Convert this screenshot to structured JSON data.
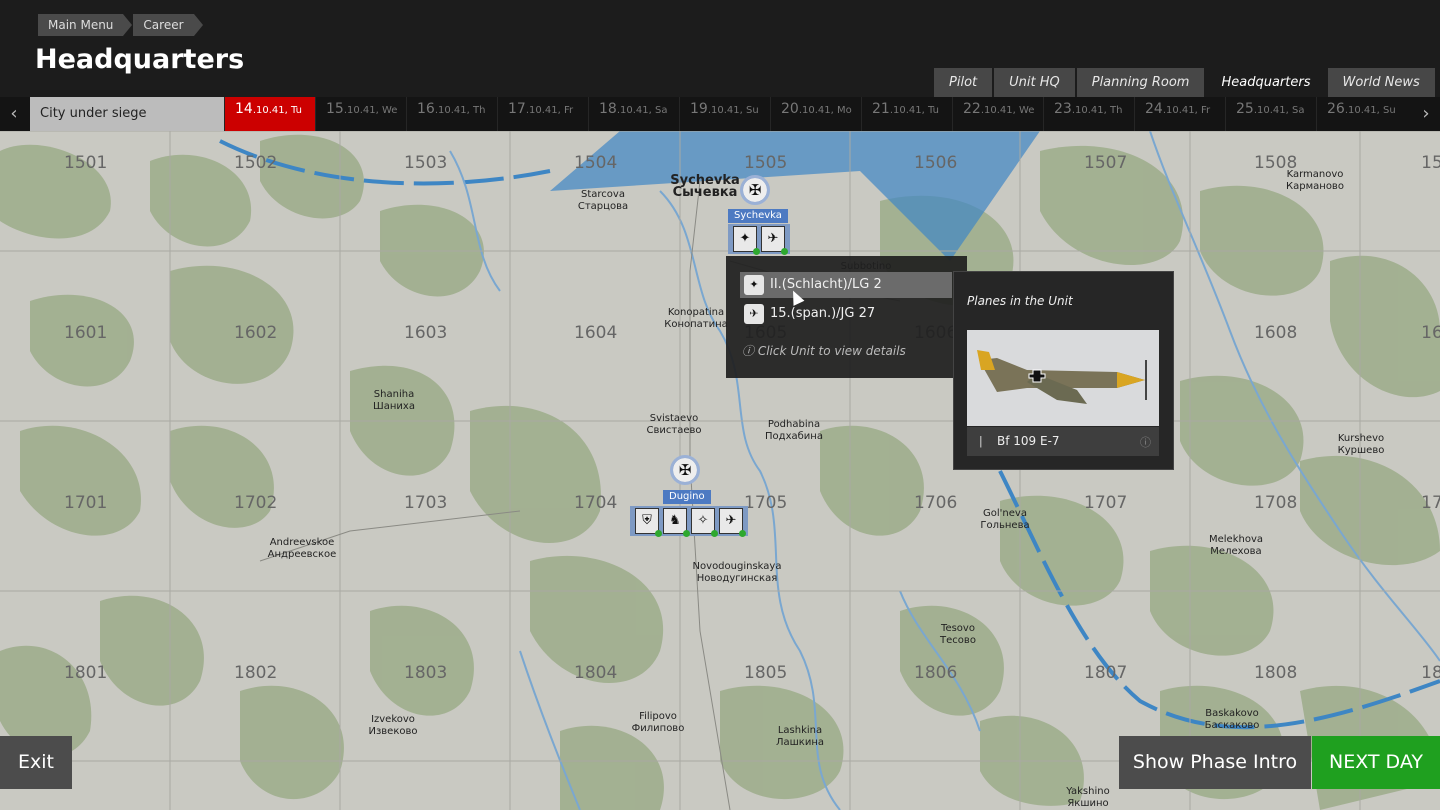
{
  "breadcrumb": [
    "Main Menu",
    "Career"
  ],
  "page_title": "Headquarters",
  "tabs": [
    {
      "label": "Pilot",
      "active": false
    },
    {
      "label": "Unit HQ",
      "active": false
    },
    {
      "label": "Planning Room",
      "active": false
    },
    {
      "label": "Headquarters",
      "active": true
    },
    {
      "label": "World News",
      "active": false
    }
  ],
  "timeline": {
    "phase": "City under siege",
    "days": [
      {
        "day": "14",
        "rest": ".10.41, Tu",
        "active": true
      },
      {
        "day": "15",
        "rest": ".10.41, We"
      },
      {
        "day": "16",
        "rest": ".10.41, Th"
      },
      {
        "day": "17",
        "rest": ".10.41, Fr"
      },
      {
        "day": "18",
        "rest": ".10.41, Sa"
      },
      {
        "day": "19",
        "rest": ".10.41, Su"
      },
      {
        "day": "20",
        "rest": ".10.41, Mo"
      },
      {
        "day": "21",
        "rest": ".10.41, Tu"
      },
      {
        "day": "22",
        "rest": ".10.41, We"
      },
      {
        "day": "23",
        "rest": ".10.41, Th"
      },
      {
        "day": "24",
        "rest": ".10.41, Fr"
      },
      {
        "day": "25",
        "rest": ".10.41, Sa"
      },
      {
        "day": "26",
        "rest": ".10.41, Su"
      }
    ],
    "prev_icon": "chevron-left-icon",
    "next_icon": "chevron-right-icon"
  },
  "map": {
    "grid_numbers": [
      [
        "1501",
        "1502",
        "1503",
        "1504",
        "1505",
        "1506",
        "1507",
        "1508",
        "15"
      ],
      [
        "1601",
        "1602",
        "1603",
        "1604",
        "1605",
        "1606",
        "1607",
        "1608",
        "16"
      ],
      [
        "1701",
        "1702",
        "1703",
        "1704",
        "1705",
        "1706",
        "1707",
        "1708",
        "17"
      ],
      [
        "1801",
        "1802",
        "1803",
        "1804",
        "1805",
        "1806",
        "1807",
        "1808",
        "18"
      ]
    ],
    "towns": [
      {
        "name": "Sychevka",
        "local": "Сычевка",
        "big": true
      },
      {
        "name": "Starcova",
        "local": "Старцова"
      },
      {
        "name": "Karmanovo",
        "local": "Карманово"
      },
      {
        "name": "Subbotino",
        "local": ""
      },
      {
        "name": "Konopatina",
        "local": "Конопатина"
      },
      {
        "name": "Shaniha",
        "local": "Шаниха"
      },
      {
        "name": "Svistaevo",
        "local": "Свистаево"
      },
      {
        "name": "Podhabina",
        "local": "Подхабина"
      },
      {
        "name": "Kurshevo",
        "local": "Куршево"
      },
      {
        "name": "Gol'neva",
        "local": "Гольнева"
      },
      {
        "name": "Andreevskoe",
        "local": "Андреевское"
      },
      {
        "name": "Melekhova",
        "local": "Мелехова"
      },
      {
        "name": "Novodouginskaya",
        "local": "Новодугинская"
      },
      {
        "name": "Tesovo",
        "local": "Тесово"
      },
      {
        "name": "Izvekovo",
        "local": "Извеково"
      },
      {
        "name": "Filipovo",
        "local": "Филипово"
      },
      {
        "name": "Lashkina",
        "local": "Лашкина"
      },
      {
        "name": "Baskakovo",
        "local": "Баскаково"
      },
      {
        "name": "Yakshino",
        "local": "Якшино"
      }
    ],
    "bases": [
      {
        "name": "Sychevka",
        "units": [
          "II.(Schlacht)/LG 2",
          "15.(span.)/JG 27"
        ]
      },
      {
        "name": "Dugino",
        "units": [
          "unit-1",
          "unit-2",
          "unit-3",
          "unit-4"
        ]
      }
    ]
  },
  "popup": {
    "units": [
      {
        "label": "II.(Schlacht)/LG 2",
        "icon": "hawk-emblem-icon"
      },
      {
        "label": "15.(span.)/JG 27",
        "icon": "fighter-emblem-icon"
      }
    ],
    "hint": "Click Unit to view details",
    "hint_icon": "question-icon"
  },
  "planes_panel": {
    "title": "Planes in the Unit",
    "plane_name": "Bf 109 E-7",
    "plane_icon": "bomb-icon",
    "info_icon": "question-icon"
  },
  "buttons": {
    "exit": "Exit",
    "phase_intro": "Show Phase Intro",
    "next_day": "NEXT DAY"
  },
  "colors": {
    "next_day": "#1fa01f",
    "active_day": "#cc0000",
    "front_line": "#3e86c4",
    "forest": "#9fae8d"
  }
}
